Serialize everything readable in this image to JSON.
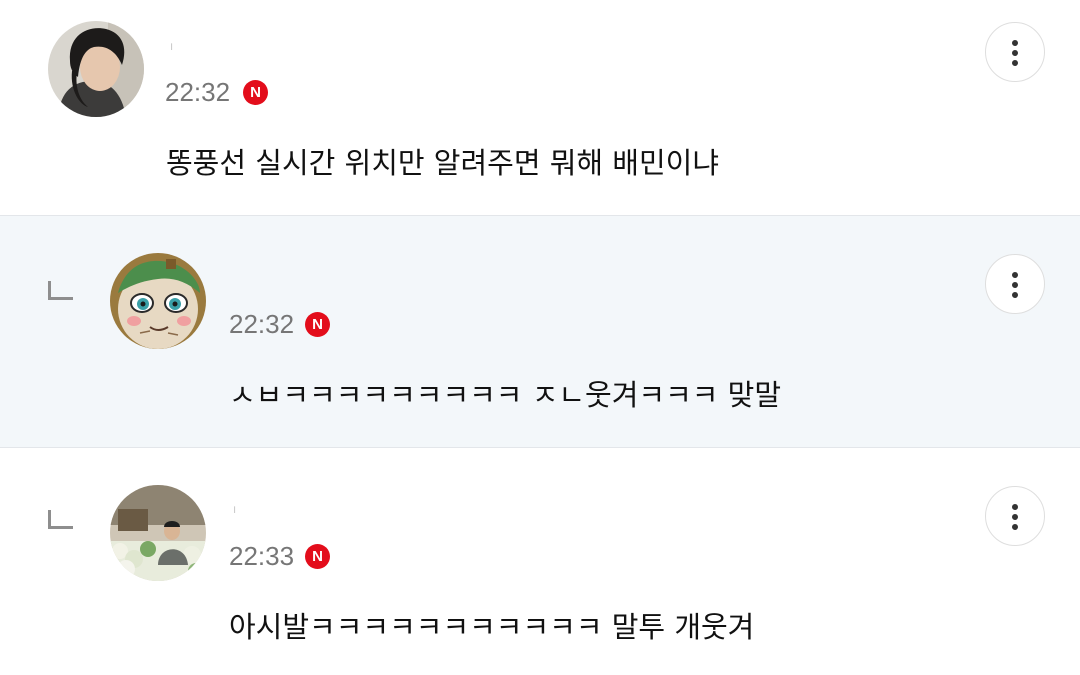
{
  "comments": [
    {
      "author": "ㅣ",
      "time": "22:32",
      "badge": "N",
      "text": "똥풍선 실시간 위치만 알려주면 뭐해 배민이냐",
      "is_reply": false
    },
    {
      "author": "",
      "time": "22:32",
      "badge": "N",
      "text": "ㅅㅂㅋㅋㅋㅋㅋㅋㅋㅋㅋ ㅈㄴ웃겨ㅋㅋㅋ 맞말",
      "is_reply": true
    },
    {
      "author": "ㅣ",
      "time": "22:33",
      "badge": "N",
      "text": "아시발ㅋㅋㅋㅋㅋㅋㅋㅋㅋㅋㅋ 말투 개웃겨",
      "is_reply": true
    }
  ],
  "colors": {
    "badge_red": "#e30d1b",
    "reply_background": "#f3f7fa",
    "time_gray": "#767676"
  },
  "icons": {
    "more": "vertical-ellipsis-icon",
    "reply": "reply-arrow-icon",
    "badge": "new-badge-icon"
  }
}
